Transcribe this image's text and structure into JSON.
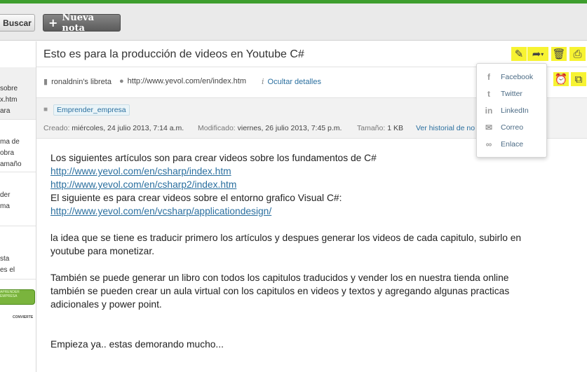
{
  "header": {
    "search_label": "Buscar",
    "new_note_label": "Nueva nota"
  },
  "note_list": {
    "items": [
      {
        "lines": [
          "sobre",
          "x.htm",
          "ara"
        ]
      },
      {
        "lines": [
          "ma de",
          "obra",
          "amaño"
        ]
      },
      {
        "lines": [
          "der",
          "ma"
        ]
      },
      {
        "lines": [
          "sta",
          "es el"
        ]
      }
    ],
    "thumb1_text": "APRENDER EMPRESA",
    "thumb2_text": "CONVIERTE"
  },
  "note": {
    "title": "Esto es para la producción de videos en Youtube  C#",
    "notebook": "ronaldnin's libreta",
    "source_url": "http://www.yevol.com/en/index.htm",
    "hide_details": "Ocultar detalles",
    "tag": "Emprender_empresa",
    "created_label": "Creado:",
    "created_value": "miércoles, 24 julio 2013, 7:14 a.m.",
    "modified_label": "Modificado:",
    "modified_value": "viernes, 26 julio 2013, 7:45 p.m.",
    "size_label": "Tamaño:",
    "size_value": "1 KB",
    "history_link": "Ver historial de no"
  },
  "share_menu": {
    "items": [
      {
        "icon": "facebook-icon",
        "glyph": "f",
        "label": "Facebook"
      },
      {
        "icon": "twitter-icon",
        "glyph": "t",
        "label": "Twitter"
      },
      {
        "icon": "linkedin-icon",
        "glyph": "in",
        "label": "LinkedIn"
      },
      {
        "icon": "mail-icon",
        "glyph": "✉",
        "label": "Correo"
      },
      {
        "icon": "link-icon",
        "glyph": "∞",
        "label": "Enlace"
      }
    ]
  },
  "content": {
    "line1": "Los siguientes artículos son para crear videos sobre los fundamentos de C#",
    "link1": "http://www.yevol.com/en/csharp/index.htm",
    "link2": "http://www.yevol.com/en/csharp2/index.htm",
    "line2": "El siguiente es para crear videos sobre el entorno grafico Visual C#:",
    "link3": "http://www.yevol.com/en/vcsharp/applicationdesign/",
    "para1_l1": "la idea que se tiene es traducir primero los artículos y despues generar los videos  de cada capitulo, subirlo en",
    "para1_l2": "youtube para monetizar.",
    "para2_l1": "También se puede generar un libro con todos los capitulos traducidos y vender los en nuestra tienda online",
    "para2_l2": "también se pueden crear un aula virtual con los capitulos en videos y textos y agregando algunas practicas",
    "para2_l3": "adicionales y power point.",
    "para3": "Empieza ya.. estas demorando mucho..."
  },
  "colors": {
    "accent_green": "#3e9e2e",
    "highlight_yellow": "#f7f332",
    "link_blue": "#2a6f9f"
  }
}
